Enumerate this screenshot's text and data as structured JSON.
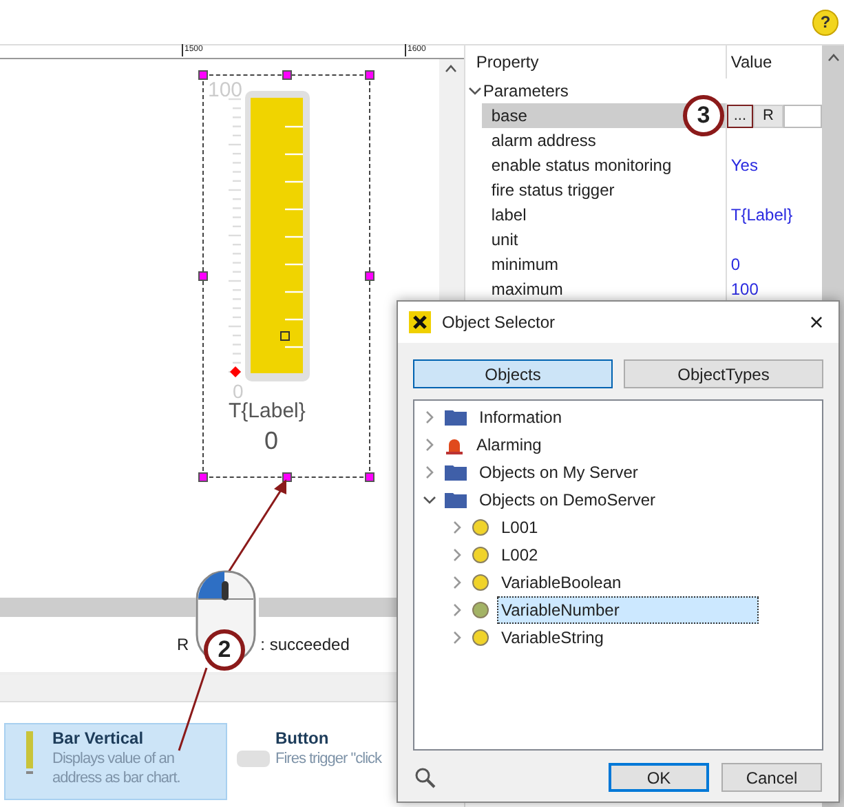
{
  "help": {
    "label": "?"
  },
  "ruler": {
    "labels": [
      "1500",
      "1600"
    ]
  },
  "gauge": {
    "scale_max": "100",
    "scale_min": "0",
    "label": "T{Label}",
    "value": "0"
  },
  "properties": {
    "columns": [
      "Property",
      "Value"
    ],
    "group": {
      "label": "Parameters",
      "expanded": true
    },
    "rows": [
      {
        "name": "base",
        "value": "",
        "selected": true,
        "kind": "editor",
        "buttons": [
          "...",
          "R"
        ]
      },
      {
        "name": "alarm address",
        "value": "",
        "selected": false,
        "kind": "text"
      },
      {
        "name": "enable status monitoring",
        "value": "Yes",
        "selected": false,
        "kind": "text"
      },
      {
        "name": "fire status trigger",
        "value": "",
        "selected": false,
        "kind": "text"
      },
      {
        "name": "label",
        "value": "T{Label}",
        "selected": false,
        "kind": "text"
      },
      {
        "name": "unit",
        "value": "",
        "selected": false,
        "kind": "text"
      },
      {
        "name": "minimum",
        "value": "0",
        "selected": false,
        "kind": "text"
      },
      {
        "name": "maximum",
        "value": "100",
        "selected": false,
        "kind": "text"
      }
    ]
  },
  "status": {
    "parts": [
      "R",
      ": succeeded"
    ]
  },
  "gallery": [
    {
      "title": "Bar Vertical",
      "description": "Displays value of an address as bar chart.",
      "selected": true,
      "kind": "bar"
    },
    {
      "title": "Button",
      "description": "Fires trigger \"click",
      "selected": false,
      "kind": "button"
    }
  ],
  "callouts": [
    "3",
    "2"
  ],
  "dialog": {
    "title": "Object Selector",
    "close": "×",
    "tabs": [
      {
        "label": "Objects",
        "selected": true
      },
      {
        "label": "ObjectTypes",
        "selected": false
      }
    ],
    "tree": [
      {
        "label": "Information",
        "kind": "folder",
        "expanded": false
      },
      {
        "label": "Alarming",
        "kind": "alarm",
        "expanded": false
      },
      {
        "label": "Objects on My Server",
        "kind": "folder",
        "expanded": false
      },
      {
        "label": "Objects on DemoServer",
        "kind": "folder",
        "expanded": true,
        "children": [
          {
            "label": "L001",
            "kind": "variable",
            "color": "#f0d32a",
            "selected": false,
            "expanded": false
          },
          {
            "label": "L002",
            "kind": "variable",
            "color": "#f0d32a",
            "selected": false,
            "expanded": false
          },
          {
            "label": "VariableBoolean",
            "kind": "variable",
            "color": "#f0d32a",
            "selected": false,
            "expanded": false
          },
          {
            "label": "VariableNumber",
            "kind": "variable",
            "color": "#a3b365",
            "selected": true,
            "expanded": false
          },
          {
            "label": "VariableString",
            "kind": "variable",
            "color": "#f0d32a",
            "selected": false,
            "expanded": false
          }
        ]
      }
    ],
    "buttons": [
      {
        "label": "OK",
        "default": true
      },
      {
        "label": "Cancel",
        "default": false
      }
    ]
  }
}
